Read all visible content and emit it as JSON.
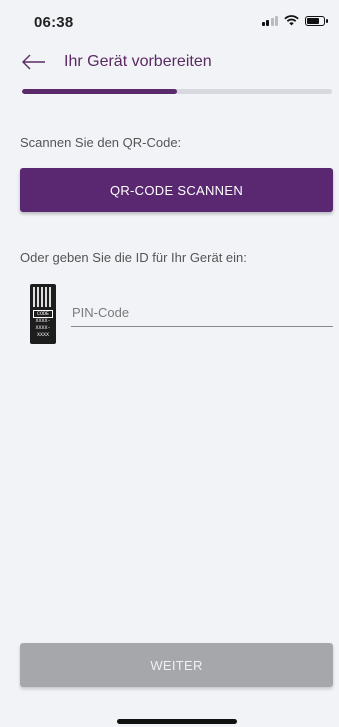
{
  "status_bar": {
    "time": "06:38",
    "icons": [
      "signal-icon",
      "wifi-icon",
      "battery-icon"
    ]
  },
  "header": {
    "back_icon": "arrow-left-icon",
    "title": "Ihr Gerät vorbereiten"
  },
  "progress": {
    "fraction": 0.5,
    "track_color": "#d7d9de",
    "fill_color": "#5b2a6b"
  },
  "scan_section": {
    "label": "Scannen Sie den QR-Code:",
    "button_label": "QR-CODE SCANNEN"
  },
  "id_section": {
    "label": "Oder geben Sie die ID für Ihr Gerät ein:",
    "card_icon": "device-id-card-icon",
    "card_code_text": "CODE",
    "card_placeholder_lines": [
      "XXXX-",
      "XXXX-",
      "XXXX"
    ],
    "pin_value": "",
    "pin_placeholder": "PIN-Code"
  },
  "footer": {
    "next_button_label": "WEITER"
  },
  "colors": {
    "accent": "#5a2870",
    "title": "#5a2a63",
    "disabled_button": "#a5a7aa",
    "background": "#f2f3f7"
  }
}
